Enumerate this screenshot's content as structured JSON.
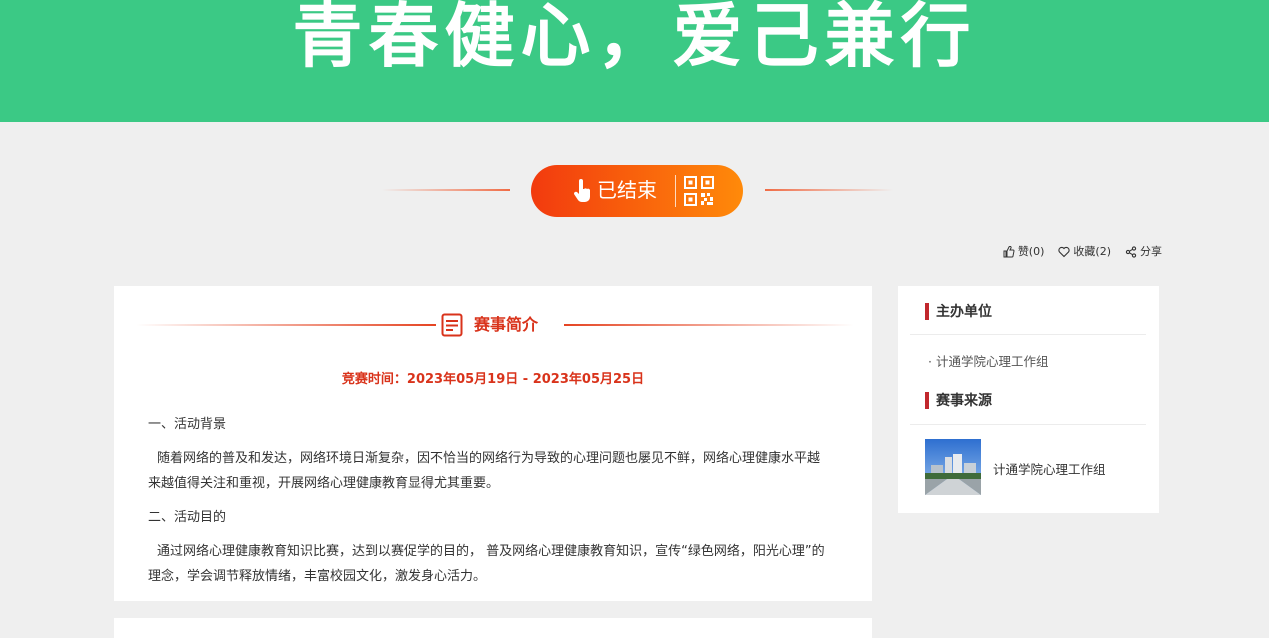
{
  "banner": {
    "slogan": "青春健心，爱己兼行",
    "bg_color": "#3bc985"
  },
  "status": {
    "label": "已结束",
    "hand_icon": "pointing-hand-icon",
    "qr_icon": "qr-code-icon"
  },
  "actions": {
    "like_label": "赞(0)",
    "favorite_label": "收藏(2)",
    "share_label": "分享"
  },
  "intro": {
    "title": "赛事简介",
    "time": "竞赛时间：2023年05月19日 - 2023年05月25日",
    "background_heading": "一、活动背景",
    "background_text": "随着网络的普及和发达，网络环境日渐复杂，因不恰当的网络行为导致的心理问题也屡见不鲜，网络心理健康水平越来越值得关注和重视，开展网络心理健康教育显得尤其重要。",
    "purpose_heading": "二、活动目的",
    "purpose_text": "通过网络心理健康教育知识比赛，达到以赛促学的目的， 普及网络心理健康教育知识，宣传“绿色网络，阳光心理”的理念，学会调节释放情绪，丰富校园文化，激发身心活力。"
  },
  "sidebar": {
    "organizer_title": "主办单位",
    "organizer_name": "· 计通学院心理工作组",
    "source_title": "赛事来源",
    "source_name": "计通学院心理工作组"
  },
  "colors": {
    "accent": "#d9331b",
    "section_bar": "#c1272d",
    "pill_start": "#f23a0e",
    "pill_end": "#ff8a0a"
  }
}
